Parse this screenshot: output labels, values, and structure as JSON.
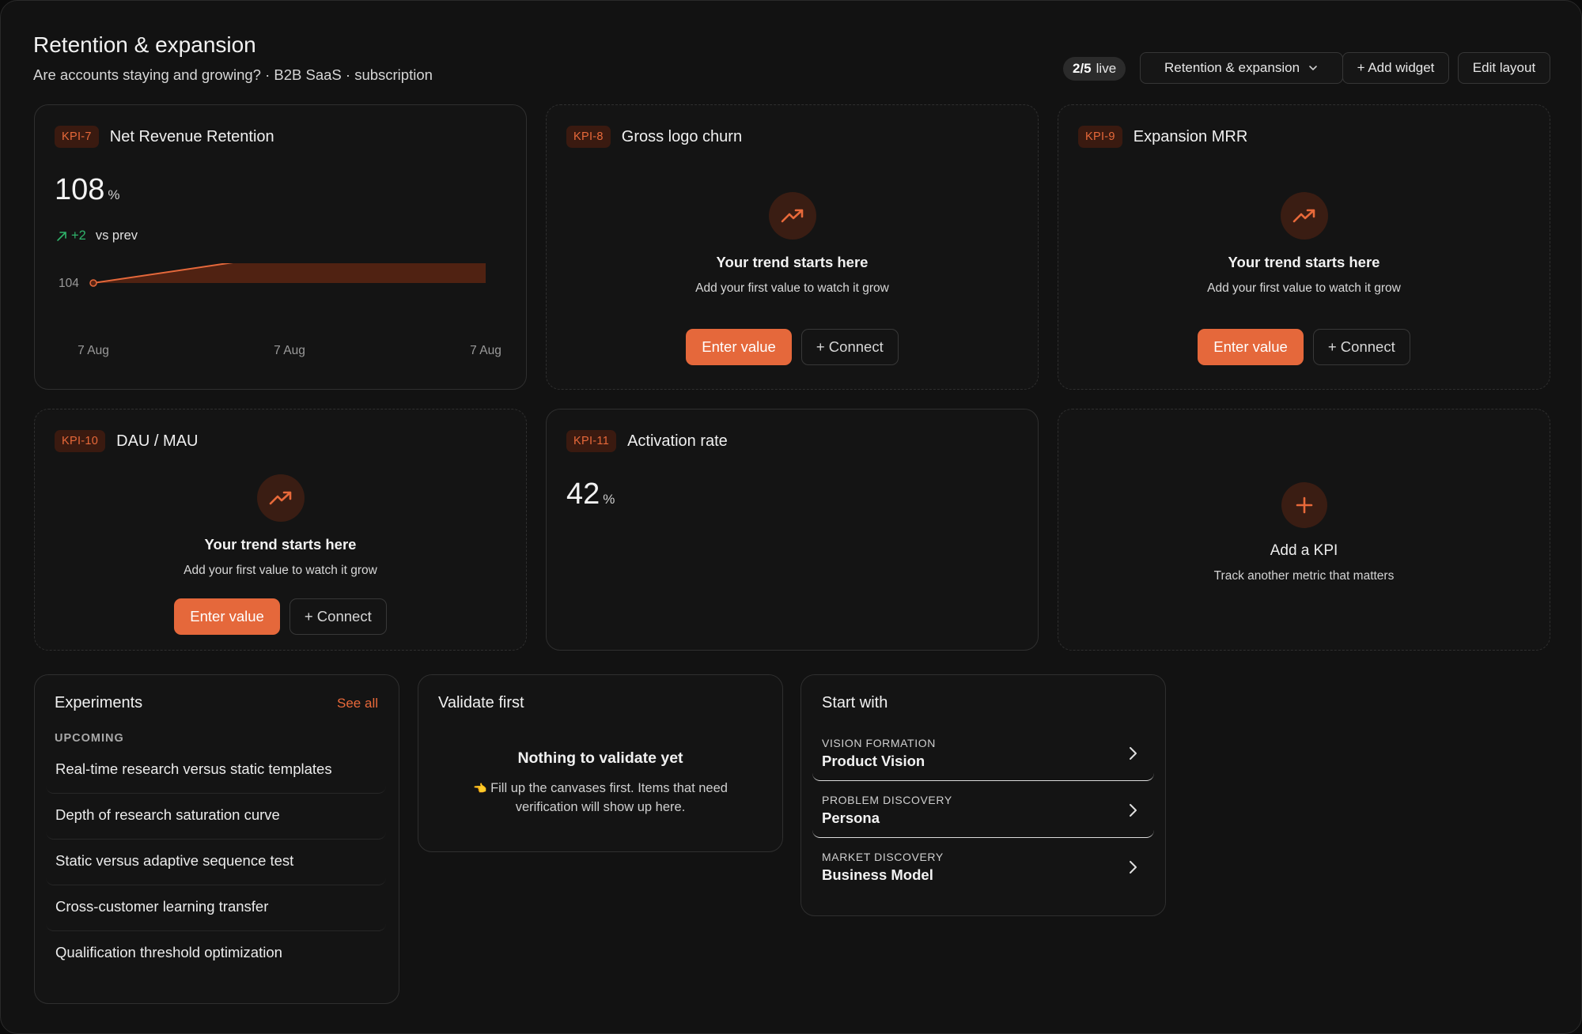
{
  "header": {
    "title": "Retention & expansion",
    "subtitle": "Are accounts staying and growing? · B2B SaaS · subscription",
    "live_count": "2/5",
    "live_label": "live",
    "dashboard_select": "Retention & expansion",
    "add_widget_label": "+ Add widget",
    "edit_layout_label": "Edit layout"
  },
  "kpis": {
    "nrr": {
      "tag": "KPI-7",
      "name": "Net Revenue Retention",
      "value": "108",
      "unit": "%",
      "delta": "+2",
      "delta_label": "vs prev"
    },
    "churn": {
      "tag": "KPI-8",
      "name": "Gross logo churn",
      "empty_title": "Your trend starts here",
      "empty_sub": "Add your first value to watch it grow",
      "enter_label": "Enter value",
      "connect_label": "+ Connect"
    },
    "expansion": {
      "tag": "KPI-9",
      "name": "Expansion MRR",
      "empty_title": "Your trend starts here",
      "empty_sub": "Add your first value to watch it grow",
      "enter_label": "Enter value",
      "connect_label": "+ Connect"
    },
    "dau": {
      "tag": "KPI-10",
      "name": "DAU / MAU",
      "empty_title": "Your trend starts here",
      "empty_sub": "Add your first value to watch it grow",
      "enter_label": "Enter value",
      "connect_label": "+ Connect"
    },
    "activation": {
      "tag": "KPI-11",
      "name": "Activation rate",
      "value": "42",
      "unit": "%"
    },
    "add": {
      "title": "Add a KPI",
      "sub": "Track another metric that matters"
    }
  },
  "chart_data": {
    "type": "area",
    "x": [
      "7 Aug",
      "7 Aug",
      "7 Aug"
    ],
    "values": [
      104,
      106,
      108
    ],
    "ylim": [
      104,
      108
    ],
    "yticks": [
      "108",
      "106",
      "104"
    ],
    "xlabel": "",
    "ylabel": "",
    "title": "",
    "color": "#e5683b"
  },
  "experiments": {
    "title": "Experiments",
    "see_all": "See all",
    "section": "UPCOMING",
    "items": [
      "Real-time research versus static templates",
      "Depth of research saturation curve",
      "Static versus adaptive sequence test",
      "Cross-customer learning transfer",
      "Qualification threshold optimization"
    ]
  },
  "validate": {
    "title": "Validate first",
    "empty_title": "Nothing to validate yet",
    "empty_line1": "Fill up the canvases first. Items that need",
    "empty_line2": "verification will show up here.",
    "hand_icon": "👈"
  },
  "start_with": {
    "title": "Start with",
    "items": [
      {
        "category": "VISION FORMATION",
        "name": "Product Vision"
      },
      {
        "category": "PROBLEM DISCOVERY",
        "name": "Persona"
      },
      {
        "category": "MARKET DISCOVERY",
        "name": "Business Model"
      }
    ]
  },
  "colors": {
    "accent": "#e5683b",
    "positive": "#2fb36b",
    "background": "#121212"
  }
}
